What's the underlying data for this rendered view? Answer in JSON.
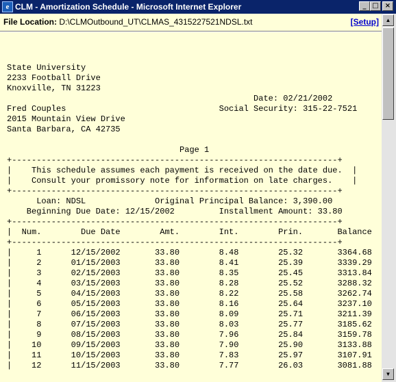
{
  "window": {
    "title": "CLM - Amortization Schedule - Microsoft Internet Explorer",
    "icon": "ie-icon",
    "minimize_glyph": "_",
    "maximize_glyph": "□",
    "close_glyph": "×"
  },
  "file_location": {
    "label": "File Location:",
    "path": "D:\\CLMOutbound_UT\\CLMAS_4315227521NDSL.txt",
    "setup_link": "[Setup]"
  },
  "document": {
    "lines": [
      "State University",
      "2233 Football Drive",
      "Knoxville, TN 31223",
      "                                                  Date: 02/21/2002",
      "Fred Couples                               Social Security: 315-22-7521",
      "2015 Mountain View Drive",
      "Santa Barbara, CA 42735",
      "",
      "                                   Page 1",
      "+------------------------------------------------------------------+",
      "|    This schedule assumes each payment is received on the date due.  |",
      "|    Consult your promissory note for information on late charges.    |",
      "+------------------------------------------------------------------+",
      "      Loan: NDSL              Original Principal Balance: 3,390.00",
      "    Beginning Due Date: 12/15/2002         Installment Amount: 33.80",
      "+------------------------------------------------------------------+",
      "|  Num.        Due Date        Amt.        Int.        Prin.       Balance  |",
      "+------------------------------------------------------------------+",
      "|     1      12/15/2002       33.80        8.48        25.32       3364.68  |",
      "|     2      01/15/2003       33.80        8.41        25.39       3339.29  |",
      "|     3      02/15/2003       33.80        8.35        25.45       3313.84  |",
      "|     4      03/15/2003       33.80        8.28        25.52       3288.32  |",
      "|     5      04/15/2003       33.80        8.22        25.58       3262.74  |",
      "|     6      05/15/2003       33.80        8.16        25.64       3237.10  |",
      "|     7      06/15/2003       33.80        8.09        25.71       3211.39  |",
      "|     8      07/15/2003       33.80        8.03        25.77       3185.62  |",
      "|     9      08/15/2003       33.80        7.96        25.84       3159.78  |",
      "|    10      09/15/2003       33.80        7.90        25.90       3133.88  |",
      "|    11      10/15/2003       33.80        7.83        25.97       3107.91  |",
      "|    12      11/15/2003       33.80        7.77        26.03       3081.88  |"
    ]
  },
  "scrollbar": {
    "up_glyph": "▲",
    "down_glyph": "▼"
  }
}
